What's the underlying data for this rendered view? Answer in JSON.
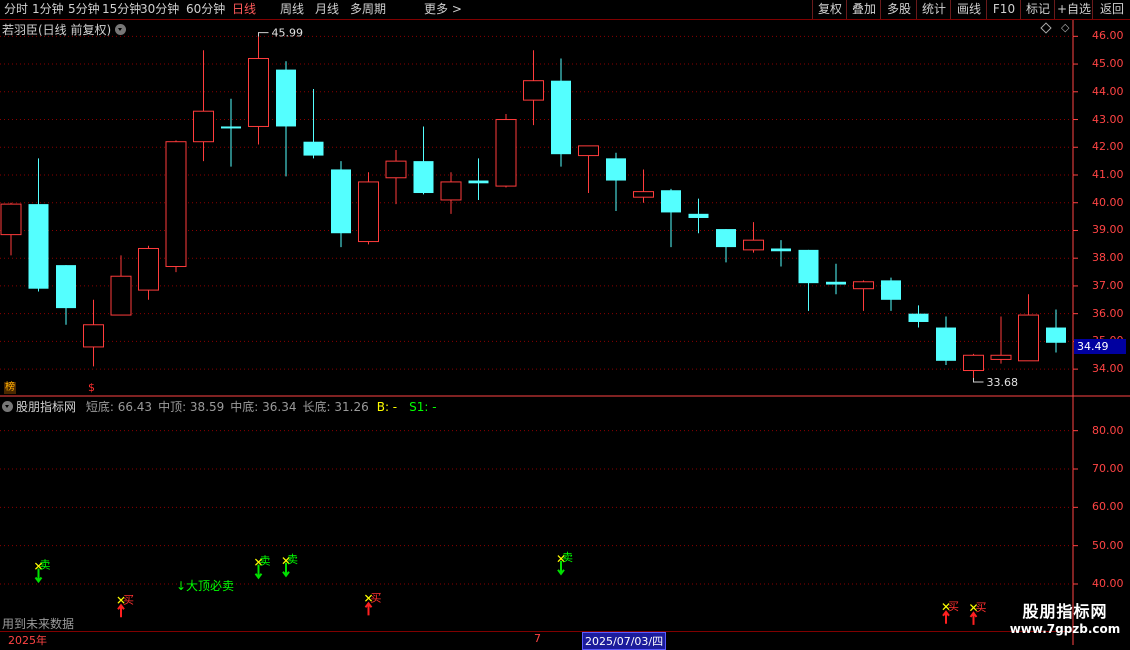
{
  "toolbar": {
    "periods": [
      "分时",
      "1分钟",
      "5分钟",
      "15分钟",
      "30分钟",
      "60分钟",
      "日线",
      "周线",
      "月线",
      "多周期",
      "更多 >"
    ],
    "active_period": "日线",
    "right_buttons": [
      "复权",
      "叠加",
      "多股",
      "统计",
      "画线",
      "F10",
      "标记",
      "+自选",
      "返回"
    ]
  },
  "main": {
    "title": "若羽臣(日线 前复权)",
    "high_label": "45.99",
    "low_label": "33.68",
    "current_price": "34.49",
    "y_ticks": [
      "46.00",
      "45.00",
      "44.00",
      "43.00",
      "42.00",
      "41.00",
      "40.00",
      "39.00",
      "38.00",
      "37.00",
      "36.00",
      "35.00",
      "34.00"
    ],
    "badge": "榜",
    "marker": "$"
  },
  "indicator": {
    "name": "股朋指标网",
    "params": [
      {
        "label": "短底:",
        "value": "66.43"
      },
      {
        "label": "中顶:",
        "value": "38.59"
      },
      {
        "label": "中底:",
        "value": "36.34"
      },
      {
        "label": "长底:",
        "value": "31.26"
      }
    ],
    "b_label": "B: -",
    "s1_label": "S1: -",
    "y_ticks": [
      "80.00",
      "70.00",
      "60.00",
      "50.00",
      "40.00"
    ],
    "signals": {
      "sell": "卖",
      "buy": "买",
      "top_sell": "大顶必卖"
    },
    "footnote": "用到未来数据"
  },
  "datebar": {
    "year": "2025年",
    "mark": "7",
    "cursor_date": "2025/07/03/四"
  },
  "watermark": {
    "title": "股朋指标网",
    "url": "www.7gpzb.com"
  },
  "colors": {
    "up": "#ff3c3c",
    "down": "#54ffff",
    "grid": "#8a0000",
    "axis": "#ff4444"
  },
  "chart_data": {
    "type": "candlestick",
    "ylim": [
      33.5,
      46.3
    ],
    "candles": [
      {
        "o": 38.85,
        "h": 40.0,
        "l": 38.1,
        "c": 39.95
      },
      {
        "o": 39.95,
        "h": 41.6,
        "l": 36.8,
        "c": 36.9
      },
      {
        "o": 37.75,
        "h": 37.75,
        "l": 35.6,
        "c": 36.2
      },
      {
        "o": 34.8,
        "h": 36.5,
        "l": 34.1,
        "c": 35.6
      },
      {
        "o": 35.95,
        "h": 38.1,
        "l": 35.95,
        "c": 37.35
      },
      {
        "o": 36.85,
        "h": 38.45,
        "l": 36.5,
        "c": 38.35
      },
      {
        "o": 37.7,
        "h": 42.25,
        "l": 37.5,
        "c": 42.2
      },
      {
        "o": 42.2,
        "h": 45.5,
        "l": 41.5,
        "c": 43.3
      },
      {
        "o": 42.75,
        "h": 43.75,
        "l": 41.3,
        "c": 42.7
      },
      {
        "o": 42.75,
        "h": 45.99,
        "l": 42.1,
        "c": 45.2
      },
      {
        "o": 44.8,
        "h": 45.1,
        "l": 40.95,
        "c": 42.75
      },
      {
        "o": 42.2,
        "h": 44.1,
        "l": 41.6,
        "c": 41.7
      },
      {
        "o": 41.2,
        "h": 41.5,
        "l": 38.4,
        "c": 38.9
      },
      {
        "o": 38.6,
        "h": 41.1,
        "l": 38.5,
        "c": 40.75
      },
      {
        "o": 40.9,
        "h": 41.9,
        "l": 39.95,
        "c": 41.5
      },
      {
        "o": 41.5,
        "h": 42.75,
        "l": 40.3,
        "c": 40.35
      },
      {
        "o": 40.1,
        "h": 41.1,
        "l": 39.6,
        "c": 40.75
      },
      {
        "o": 40.8,
        "h": 41.6,
        "l": 40.1,
        "c": 40.7
      },
      {
        "o": 40.6,
        "h": 43.2,
        "l": 40.55,
        "c": 43.0
      },
      {
        "o": 43.7,
        "h": 45.5,
        "l": 42.8,
        "c": 44.4
      },
      {
        "o": 44.4,
        "h": 45.2,
        "l": 41.3,
        "c": 41.75
      },
      {
        "o": 41.7,
        "h": 42.05,
        "l": 40.35,
        "c": 42.05
      },
      {
        "o": 41.6,
        "h": 41.8,
        "l": 39.7,
        "c": 40.8
      },
      {
        "o": 40.2,
        "h": 41.2,
        "l": 40.0,
        "c": 40.4
      },
      {
        "o": 40.45,
        "h": 40.5,
        "l": 38.4,
        "c": 39.65
      },
      {
        "o": 39.6,
        "h": 40.15,
        "l": 38.9,
        "c": 39.45
      },
      {
        "o": 39.05,
        "h": 39.05,
        "l": 37.85,
        "c": 38.4
      },
      {
        "o": 38.3,
        "h": 39.3,
        "l": 38.2,
        "c": 38.65
      },
      {
        "o": 38.35,
        "h": 38.65,
        "l": 37.7,
        "c": 38.25
      },
      {
        "o": 38.3,
        "h": 38.3,
        "l": 36.1,
        "c": 37.1
      },
      {
        "o": 37.15,
        "h": 37.8,
        "l": 36.7,
        "c": 37.05
      },
      {
        "o": 36.9,
        "h": 37.2,
        "l": 36.1,
        "c": 37.15
      },
      {
        "o": 37.2,
        "h": 37.3,
        "l": 36.1,
        "c": 36.5
      },
      {
        "o": 36.0,
        "h": 36.3,
        "l": 35.5,
        "c": 35.7
      },
      {
        "o": 35.5,
        "h": 35.9,
        "l": 34.15,
        "c": 34.3
      },
      {
        "o": 33.95,
        "h": 34.55,
        "l": 33.68,
        "c": 34.5
      },
      {
        "o": 34.35,
        "h": 35.9,
        "l": 34.2,
        "c": 34.5
      },
      {
        "o": 34.3,
        "h": 36.7,
        "l": 34.3,
        "c": 35.95
      },
      {
        "o": 35.5,
        "h": 36.15,
        "l": 34.6,
        "c": 34.95
      }
    ],
    "indicator_ylim": [
      28,
      88
    ],
    "signal_marks": [
      {
        "i": 1,
        "kind": "sell",
        "v": 43
      },
      {
        "i": 4,
        "kind": "buy",
        "v": 35.5
      },
      {
        "i": 6,
        "kind": "topsell",
        "v": 41
      },
      {
        "i": 9,
        "kind": "sell",
        "v": 44
      },
      {
        "i": 10,
        "kind": "sell",
        "v": 44.5
      },
      {
        "i": 13,
        "kind": "buy",
        "v": 36
      },
      {
        "i": 20,
        "kind": "sell",
        "v": 45
      },
      {
        "i": 34,
        "kind": "buy",
        "v": 33.8
      },
      {
        "i": 35,
        "kind": "buy",
        "v": 33.5
      }
    ]
  }
}
